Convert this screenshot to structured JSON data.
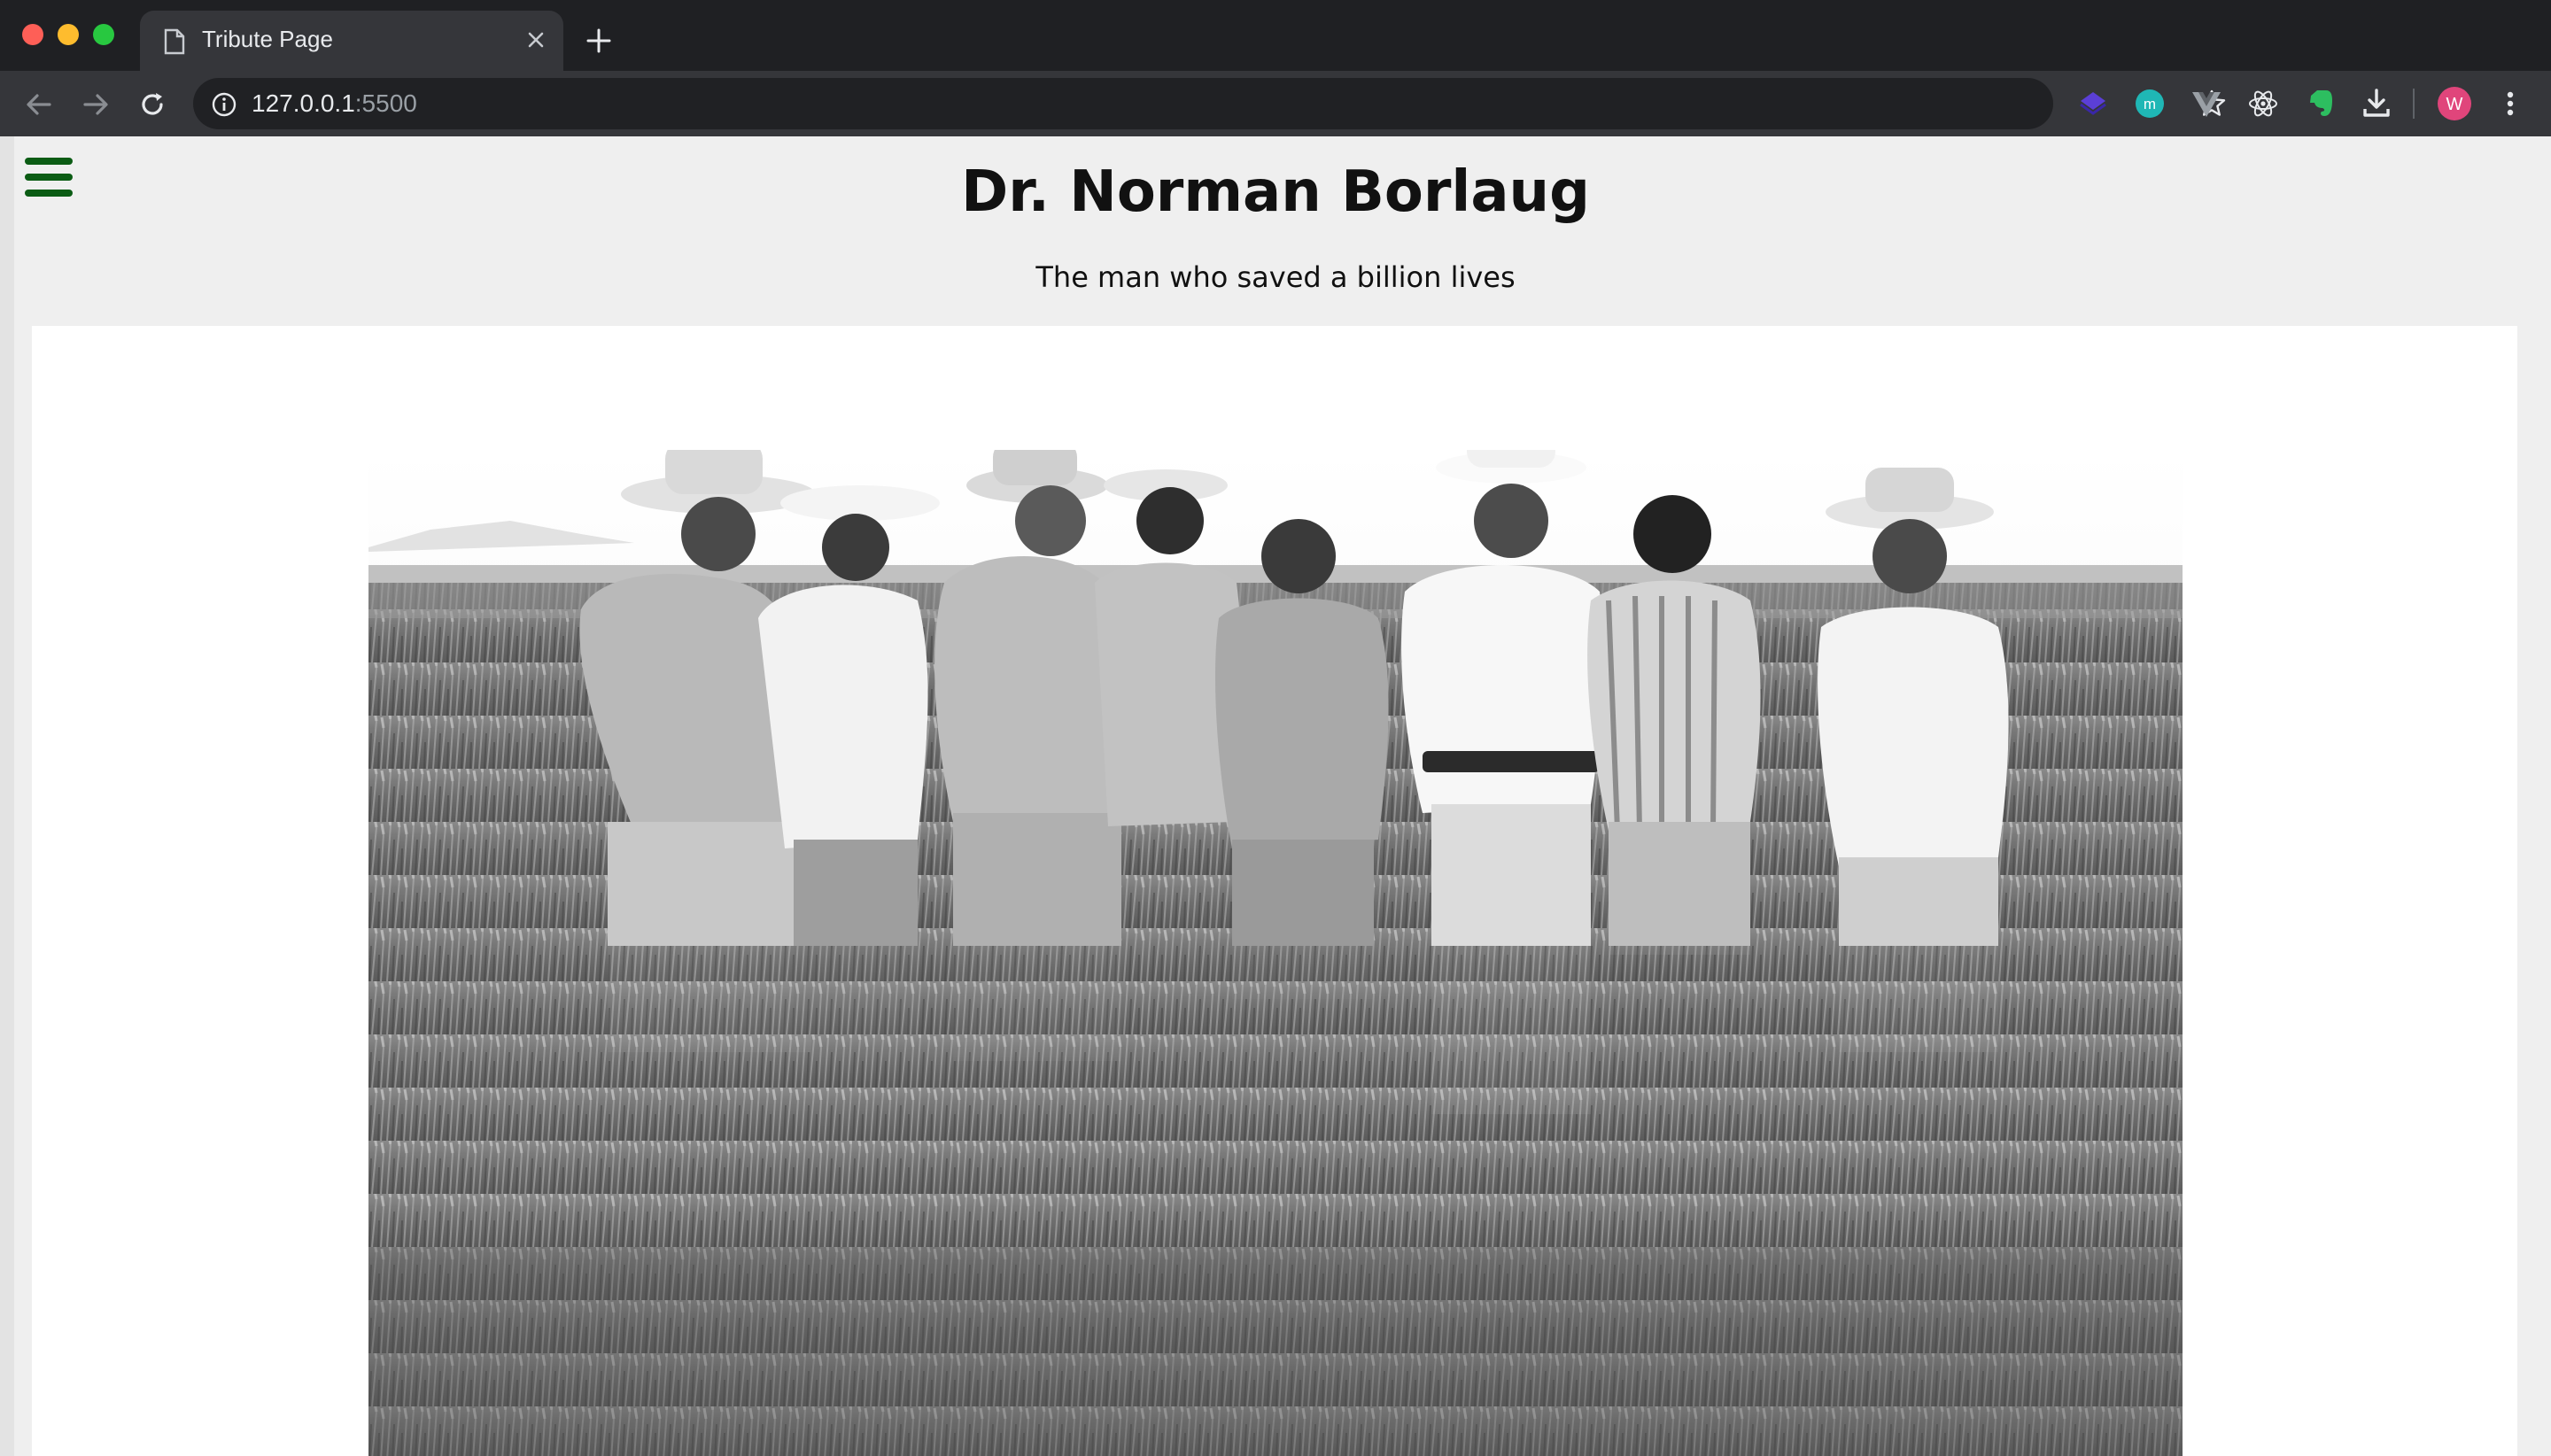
{
  "browser": {
    "tab": {
      "title": "Tribute Page",
      "icon": "document-icon"
    },
    "address_bar": {
      "host": "127.0.0.1",
      "port": ":5500",
      "icon": "info-icon"
    },
    "extensions": [
      "layers-extension-icon",
      "m-extension-icon",
      "vue-extension-icon",
      "react-extension-icon",
      "evernote-extension-icon",
      "download-icon"
    ],
    "profile": {
      "initial": "W",
      "color": "#e0457b"
    }
  },
  "page": {
    "title": "Dr. Norman Borlaug",
    "subtitle": "The man who saved a billion lives",
    "menu_icon": "hamburger-menu-icon",
    "accent_color": "#0b5c14",
    "image": {
      "subject": "black-and-white photo of men in a wheat field"
    }
  }
}
